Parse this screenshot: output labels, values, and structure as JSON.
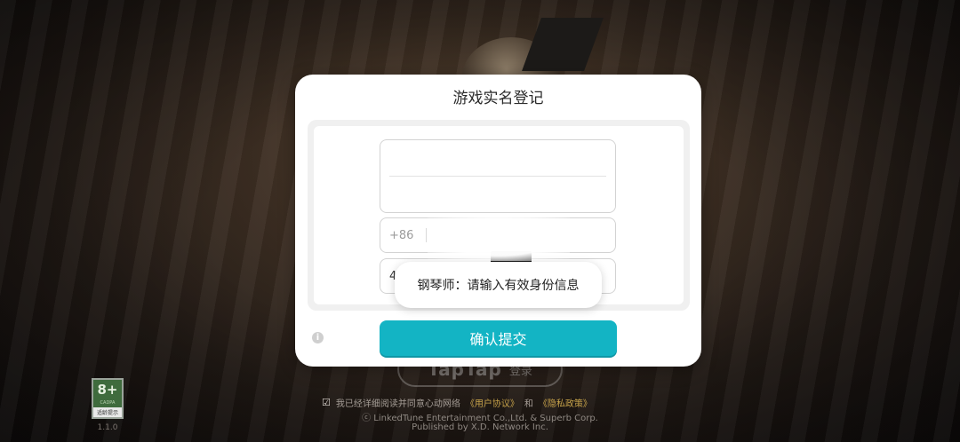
{
  "background": {
    "login_button": {
      "logo": "TapTap",
      "label": "登录"
    },
    "age_rating": {
      "rating": "8+",
      "org": "CADPA",
      "tip": "适龄提示"
    },
    "version": "1.1.0",
    "agreement": {
      "checkbox": "☑",
      "text": "我已经详细阅读并同意心动网络",
      "user_agreement": "《用户协议》",
      "and": "和",
      "privacy_policy": "《隐私政策》"
    },
    "copyright_line1": "ⓒ LinkedTune Entertainment Co.,Ltd. & Superb Corp.",
    "copyright_line2": "Published by X.D. Network Inc."
  },
  "dialog": {
    "title": "游戏实名登记",
    "phone_prefix": "+86",
    "id_value": "4",
    "confirm_label": "确认提交",
    "info_icon": "i"
  },
  "toast": {
    "message": "钢琴师：请输入有效身份信息"
  },
  "colors": {
    "accent": "#13b4c4",
    "link": "#c6a24a"
  }
}
